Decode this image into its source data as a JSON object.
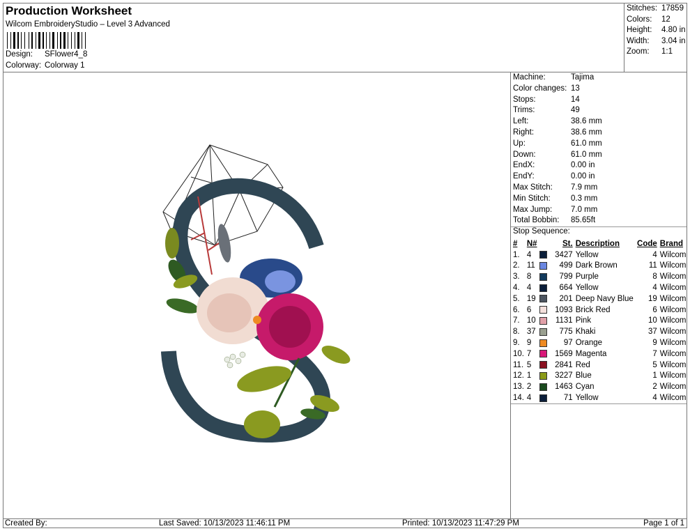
{
  "header": {
    "title": "Production Worksheet",
    "subtitle": "Wilcom EmbroideryStudio – Level 3 Advanced",
    "design_label": "Design:",
    "design_value": "SFlower4_8",
    "colorway_label": "Colorway:",
    "colorway_value": "Colorway 1"
  },
  "stats": [
    {
      "label": "Stitches:",
      "value": "17859"
    },
    {
      "label": "Colors:",
      "value": "12"
    },
    {
      "label": "Height:",
      "value": "4.80 in"
    },
    {
      "label": "Width:",
      "value": "3.04 in"
    },
    {
      "label": "Zoom:",
      "value": "1:1"
    }
  ],
  "properties": [
    {
      "label": "Machine:",
      "value": "Tajima"
    },
    {
      "label": "Color changes:",
      "value": "13"
    },
    {
      "label": "Stops:",
      "value": "14"
    },
    {
      "label": "Trims:",
      "value": "49"
    },
    {
      "label": "Left:",
      "value": "38.6 mm"
    },
    {
      "label": "Right:",
      "value": "38.6 mm"
    },
    {
      "label": "Up:",
      "value": "61.0 mm"
    },
    {
      "label": "Down:",
      "value": "61.0 mm"
    },
    {
      "label": "EndX:",
      "value": "0.00 in"
    },
    {
      "label": "EndY:",
      "value": "0.00 in"
    },
    {
      "label": "Max Stitch:",
      "value": "7.9 mm"
    },
    {
      "label": "Min Stitch:",
      "value": "0.3 mm"
    },
    {
      "label": "Max Jump:",
      "value": "7.0 mm"
    },
    {
      "label": "Total Bobbin:",
      "value": "85.65ft"
    }
  ],
  "stop_sequence": {
    "heading": "Stop Sequence:",
    "columns": {
      "idx": "#",
      "n": "N#",
      "st": "St.",
      "desc": "Description",
      "code": "Code",
      "brand": "Brand"
    },
    "rows": [
      {
        "idx": "1.",
        "n": "4",
        "color": "#0b1e3a",
        "st": "3427",
        "desc": "Yellow",
        "code": "4",
        "brand": "Wilcom"
      },
      {
        "idx": "2.",
        "n": "11",
        "color": "#6a86e0",
        "st": "499",
        "desc": "Dark Brown",
        "code": "11",
        "brand": "Wilcom"
      },
      {
        "idx": "3.",
        "n": "8",
        "color": "#123a5c",
        "st": "799",
        "desc": "Purple",
        "code": "8",
        "brand": "Wilcom"
      },
      {
        "idx": "4.",
        "n": "4",
        "color": "#0b1e3a",
        "st": "664",
        "desc": "Yellow",
        "code": "4",
        "brand": "Wilcom"
      },
      {
        "idx": "5.",
        "n": "19",
        "color": "#4d5560",
        "st": "201",
        "desc": "Deep Navy Blue",
        "code": "19",
        "brand": "Wilcom"
      },
      {
        "idx": "6.",
        "n": "6",
        "color": "#f4e0dc",
        "st": "1093",
        "desc": "Brick Red",
        "code": "6",
        "brand": "Wilcom"
      },
      {
        "idx": "7.",
        "n": "10",
        "color": "#e0a0a8",
        "st": "1131",
        "desc": "Pink",
        "code": "10",
        "brand": "Wilcom"
      },
      {
        "idx": "8.",
        "n": "37",
        "color": "#9aa090",
        "st": "775",
        "desc": "Khaki",
        "code": "37",
        "brand": "Wilcom"
      },
      {
        "idx": "9.",
        "n": "9",
        "color": "#ee8a22",
        "st": "97",
        "desc": "Orange",
        "code": "9",
        "brand": "Wilcom"
      },
      {
        "idx": "10.",
        "n": "7",
        "color": "#d81878",
        "st": "1569",
        "desc": "Magenta",
        "code": "7",
        "brand": "Wilcom"
      },
      {
        "idx": "11.",
        "n": "5",
        "color": "#8a1020",
        "st": "2841",
        "desc": "Red",
        "code": "5",
        "brand": "Wilcom"
      },
      {
        "idx": "12.",
        "n": "1",
        "color": "#8a9a18",
        "st": "3227",
        "desc": "Blue",
        "code": "1",
        "brand": "Wilcom"
      },
      {
        "idx": "13.",
        "n": "2",
        "color": "#1a4a1e",
        "st": "1463",
        "desc": "Cyan",
        "code": "2",
        "brand": "Wilcom"
      },
      {
        "idx": "14.",
        "n": "4",
        "color": "#0b1e3a",
        "st": "71",
        "desc": "Yellow",
        "code": "4",
        "brand": "Wilcom"
      }
    ]
  },
  "footer": {
    "created_by": "Created By:",
    "last_saved": "Last Saved: 10/13/2023 11:46:11 PM",
    "printed": "Printed: 10/13/2023 11:47:29 PM",
    "page": "Page 1 of 1"
  }
}
